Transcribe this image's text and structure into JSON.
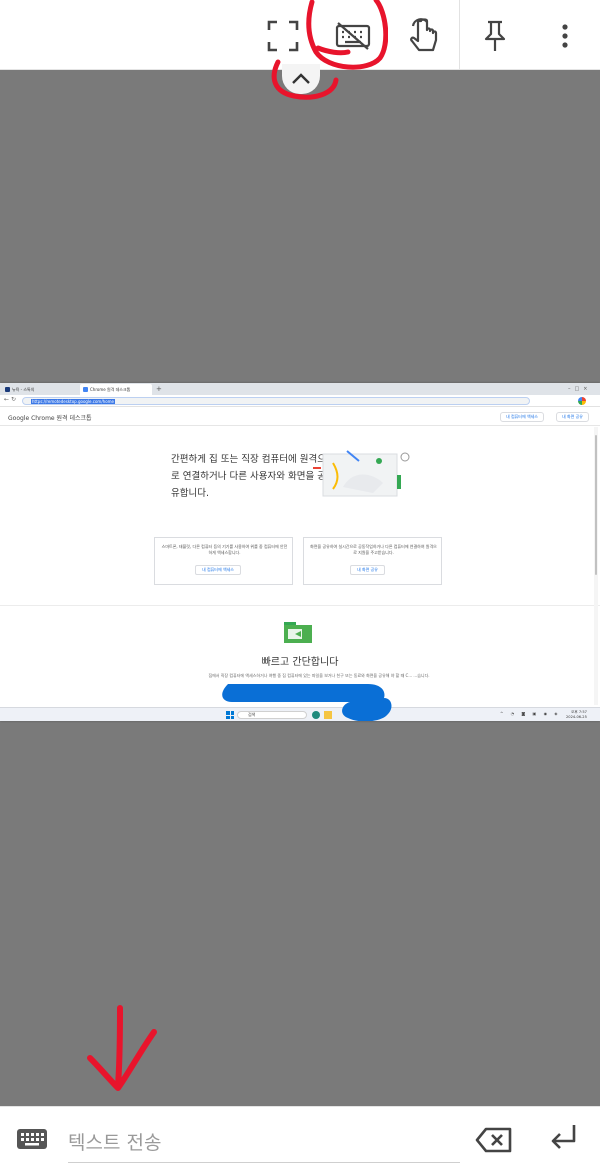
{
  "toolbar": {
    "buttons": [
      "fullscreen-icon",
      "keyboard-off-icon",
      "touch-mode-icon",
      "pin-icon",
      "more-vert-icon"
    ],
    "collapse": "chevron-up-icon"
  },
  "remote_screen": {
    "browser": {
      "tabs": [
        {
          "label": "뉴욕 - 스톡의",
          "icon_color": "#1a3a7a"
        },
        {
          "label": "Chrome 원격 데스크톱",
          "icon_color": "#4285f4"
        }
      ],
      "url": "https://remotedesktop.google.com/home"
    },
    "site": {
      "logo": "Google Chrome 원격 데스크톱",
      "header_buttons": [
        "내 컴퓨터에 액세스",
        "내 화면 공유"
      ],
      "hero_text": "간편하게 집 또는 직장 컴퓨터에 원격으로 연결하거나 다른 사용자와 화면을 공유합니다.",
      "cards": [
        {
          "text": "스마트폰, 태블릿, 다른 컴퓨터 등의 기기를 사용하여 위를 중 컴퓨터에 안전하게 액세스합니다.",
          "button": "내 컴퓨터에 액세스"
        },
        {
          "text": "화면을 공유하여 실시간으로 공동작업하거나 다른 컴퓨터에 연결하여 원격으로 지원을 주고받습니다.",
          "button": "내 화면 공유"
        }
      ],
      "section_title": "빠르고 간단합니다",
      "section_desc": "집에서 직장 컴퓨터에 액세스하거나 여행 중 집 컴퓨터에 있는 파일을 보거나 친구 또는 동료와 화면을 공유해 야 할 때 C... ...습니다."
    },
    "taskbar": {
      "search_label": "검색",
      "clock_time": "오후 7:57",
      "clock_date": "2024-06-25"
    }
  },
  "input_bar": {
    "placeholder": "텍스트 전송",
    "icons": [
      "keyboard-icon",
      "backspace-icon",
      "enter-icon"
    ]
  },
  "colors": {
    "annotation_red": "#e8142c",
    "redaction_blue": "#0a6fd6",
    "background_gray": "#7a7a7a"
  }
}
